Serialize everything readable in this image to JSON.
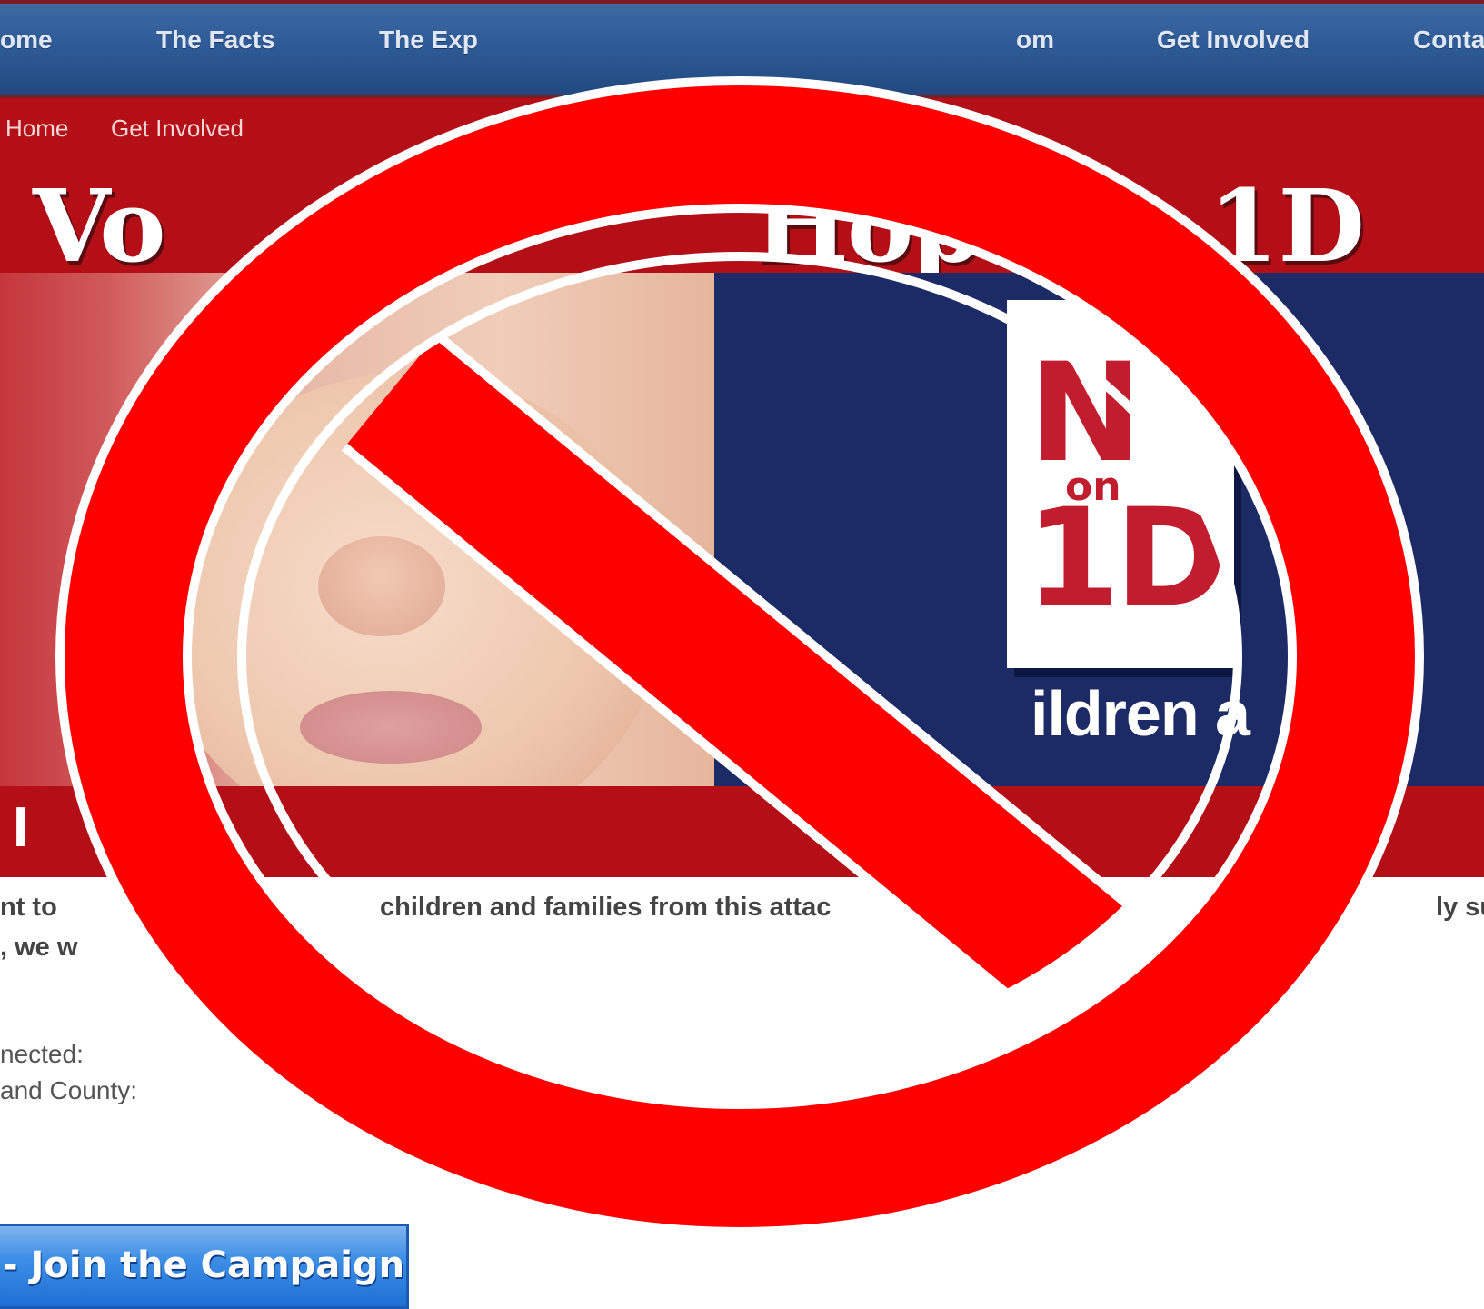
{
  "nav": {
    "items": [
      "ome",
      "The Facts",
      "The Exp",
      "om",
      "Get Involved",
      "Conta"
    ]
  },
  "subnav": {
    "items": [
      "Home",
      "Get Involved"
    ]
  },
  "banner": {
    "title_left": "Vo",
    "title_mid": "Hop",
    "title_right": "1D"
  },
  "hero": {
    "logo_n": "N",
    "logo_on": "on",
    "logo_1d": "1D",
    "tagline": "ildren a"
  },
  "redbar": {
    "text": "I"
  },
  "body": {
    "line1_a": "nt to",
    "line1_b": "children and families from this attac",
    "line1_c": "ly su",
    "line2": ", we w"
  },
  "form": {
    "field1_label": "nected:",
    "field2_label": "and County:"
  },
  "cta": {
    "label": "- Join the Campaign"
  },
  "colors": {
    "nav_blue": "#2e5b97",
    "brand_red": "#b40e16",
    "hero_navy": "#1c2a66",
    "logo_red": "#c21d2e",
    "prohibition_red": "#ff0000",
    "button_blue": "#3e8fe6"
  },
  "overlay": {
    "icon": "prohibition-sign-icon"
  }
}
